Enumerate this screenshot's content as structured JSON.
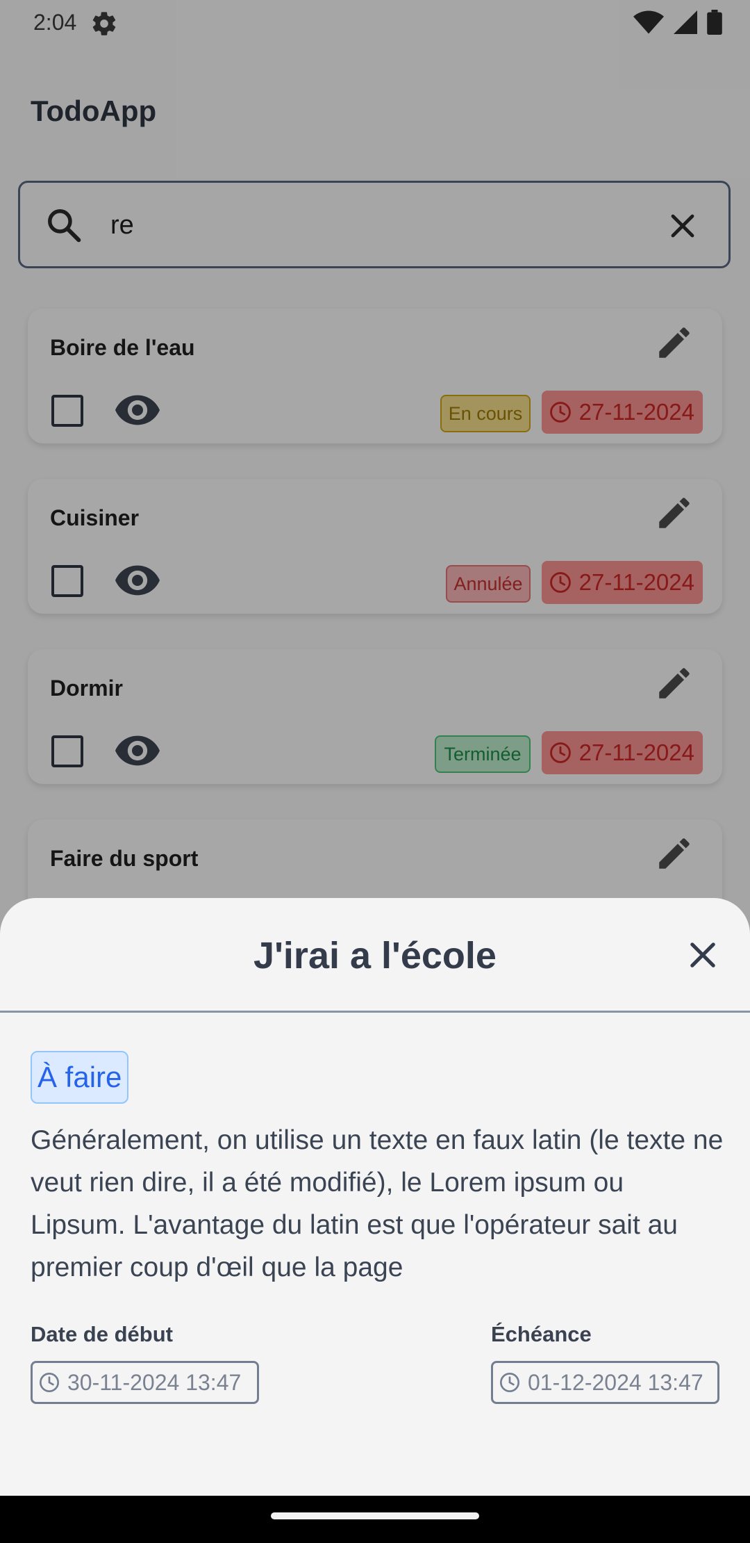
{
  "status_bar": {
    "time": "2:04",
    "icons": [
      "gear-icon",
      "wifi-icon",
      "signal-icon",
      "battery-icon"
    ]
  },
  "app": {
    "title": "TodoApp"
  },
  "search": {
    "value": "re",
    "icon": "search-icon",
    "clear_icon": "close-icon"
  },
  "todos": [
    {
      "title": "Boire de l'eau",
      "status": "En cours",
      "status_colors": {
        "bg": "#f0d98a",
        "border": "#c9a217",
        "text": "#9b7a06"
      },
      "due": "27-11-2024"
    },
    {
      "title": "Cuisiner",
      "status": "Annulée",
      "status_colors": {
        "bg": "#f4b3b3",
        "border": "#e07070",
        "text": "#c22f2f"
      },
      "due": "27-11-2024"
    },
    {
      "title": "Dormir",
      "status": "Terminée",
      "status_colors": {
        "bg": "#b9e7c9",
        "border": "#4fbf74",
        "text": "#1e8a45"
      },
      "due": "27-11-2024"
    },
    {
      "title": "Faire du sport"
    }
  ],
  "sheet": {
    "title": "J'irai a l'école",
    "state": "À faire",
    "description": "Généralement, on utilise un texte en faux latin (le texte ne veut rien dire, il a été modifié), le Lorem ipsum ou Lipsum. L'avantage du latin est que l'opérateur sait au premier coup d'œil que la page",
    "start_label": "Date de début",
    "start_value": "30-11-2024 13:47",
    "due_label": "Échéance",
    "due_value": "01-12-2024 13:47"
  },
  "colors": {
    "accent_blue": "#2563eb",
    "due_red": "#c92626",
    "text_dark": "#2f3542"
  }
}
